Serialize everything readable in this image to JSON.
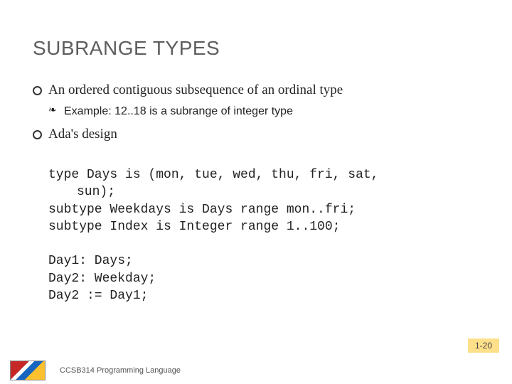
{
  "title": "SUBRANGE TYPES",
  "bullets": {
    "b1": "An ordered contiguous subsequence of an ordinal type",
    "b1_sub": "Example: 12..18 is a subrange of integer type",
    "b2": "Ada's design"
  },
  "code": {
    "l1": "type Days is (mon, tue, wed, thu, fri, sat,",
    "l2": "sun);",
    "l3": "subtype Weekdays is Days range mon..fri;",
    "l4": "subtype Index is Integer range 1..100;",
    "l5": "Day1: Days;",
    "l6": "Day2: Weekday;",
    "l7": "Day2 := Day1;"
  },
  "page_number": "1-20",
  "footer": "CCSB314 Programming Language"
}
